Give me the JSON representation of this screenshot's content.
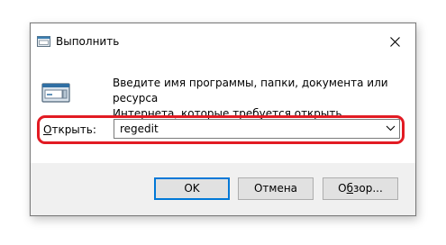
{
  "window": {
    "title": "Выполнить",
    "icon": "run-icon",
    "close_icon": "close-icon"
  },
  "description": {
    "line1": "Введите имя программы, папки, документа или ресурса",
    "line2": "Интернета, которые требуется открыть."
  },
  "open_field": {
    "label_accesskey": "О",
    "label_rest": "ткрыть:",
    "value": "regedit",
    "dropdown_icon": "chevron-down-icon",
    "highlight_color": "#e21b23"
  },
  "buttons": {
    "ok": "OK",
    "cancel": "Отмена",
    "browse_accesskey": "б",
    "browse_pre": "О",
    "browse_post": "зор..."
  },
  "colors": {
    "accent": "#0078d7",
    "footer_bg": "#f0f0f0"
  }
}
